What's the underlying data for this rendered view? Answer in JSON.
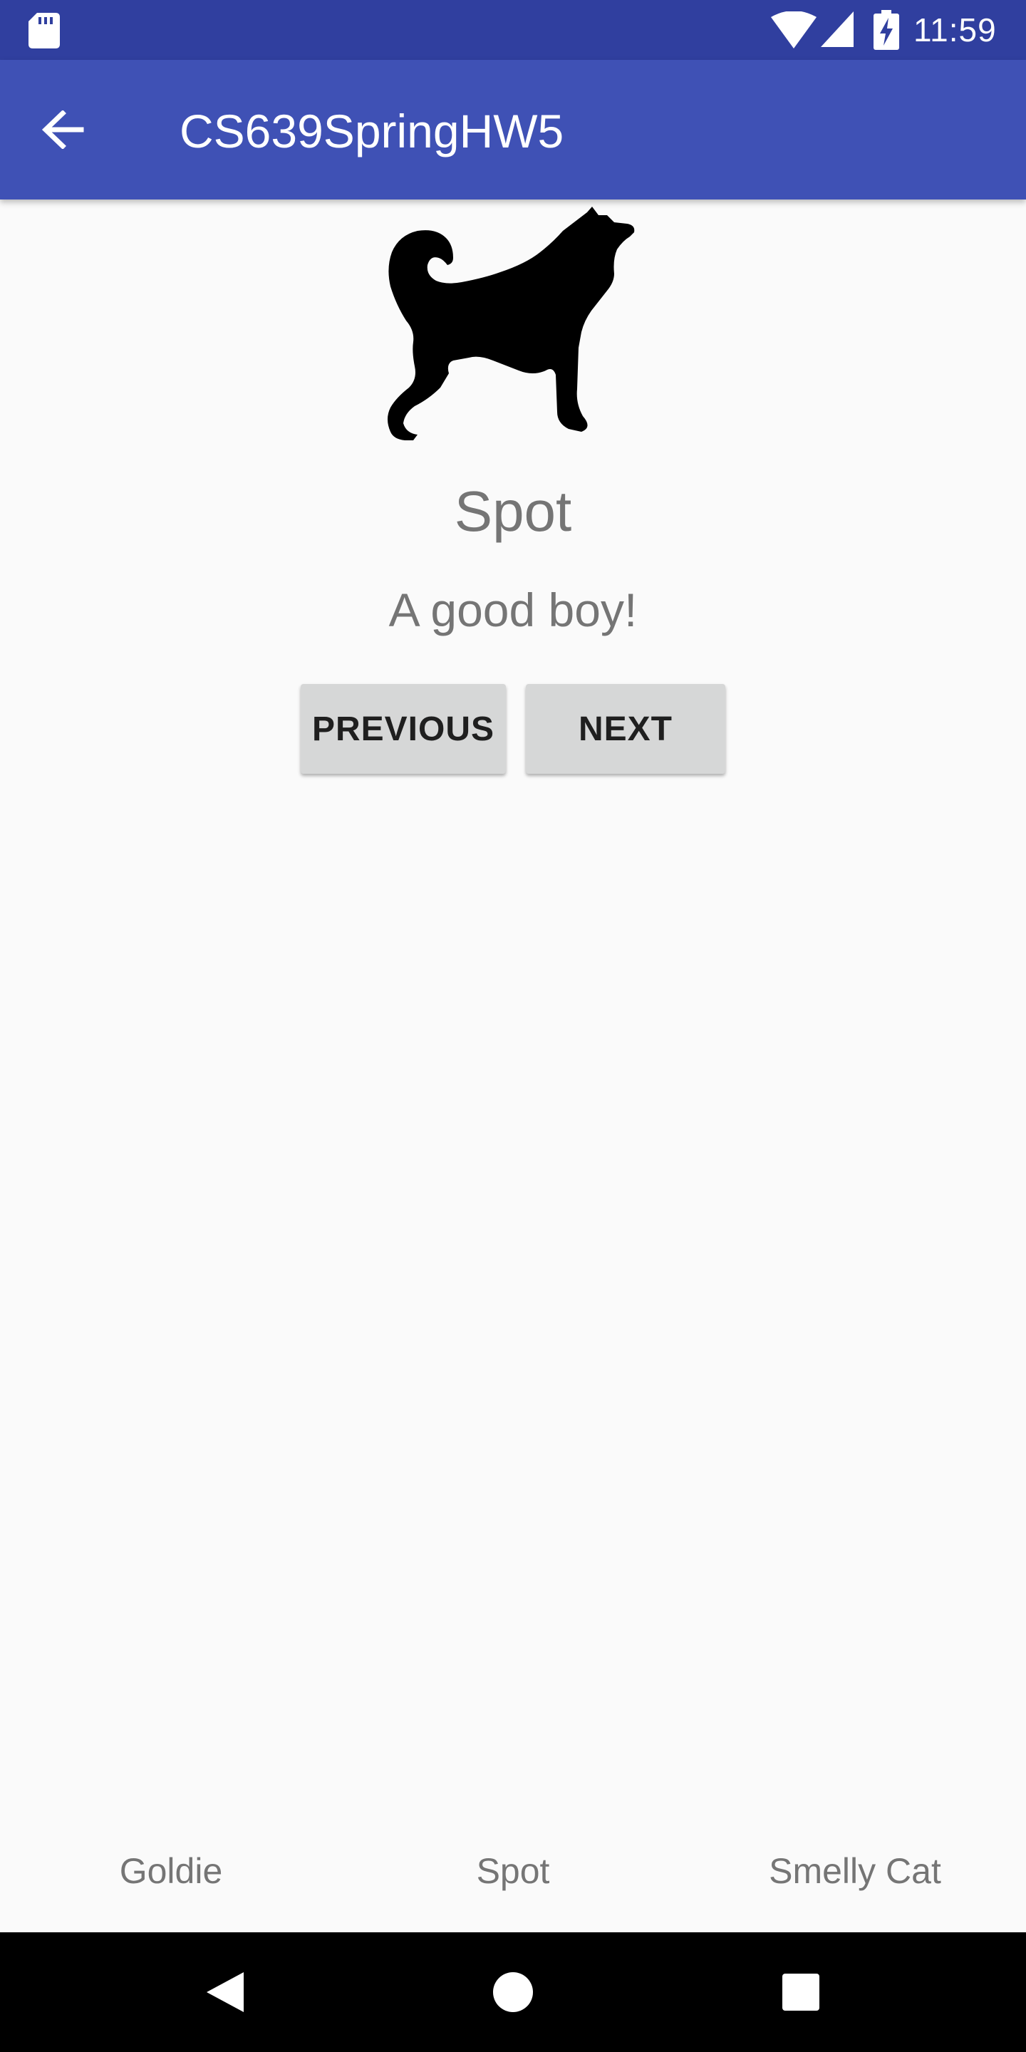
{
  "status_bar": {
    "time": "11:59",
    "icons": [
      "sd-card-icon",
      "wifi-icon",
      "cell-signal-icon",
      "battery-charging-icon"
    ]
  },
  "app_bar": {
    "title": "CS639SpringHW5",
    "back_icon": "arrow-back-icon"
  },
  "pet": {
    "image_icon": "dog-silhouette",
    "name": "Spot",
    "description": "A good boy!"
  },
  "buttons": {
    "previous": "PREVIOUS",
    "next": "NEXT"
  },
  "tabs": [
    {
      "label": "Goldie"
    },
    {
      "label": "Spot"
    },
    {
      "label": "Smelly Cat"
    }
  ],
  "nav_bar": {
    "icons": [
      "back-triangle-icon",
      "home-circle-icon",
      "recents-square-icon"
    ]
  },
  "colors": {
    "status_bar": "#303f9f",
    "app_bar": "#3f51b5",
    "background": "#fafafa",
    "button": "#d6d7d7",
    "secondary_text": "#757575"
  }
}
